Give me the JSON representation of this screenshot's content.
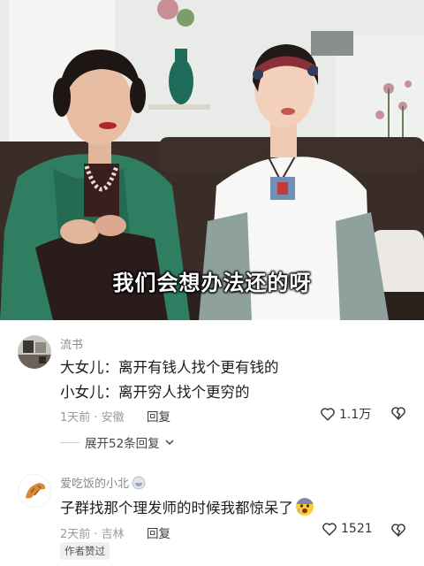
{
  "video": {
    "subtitle": "我们会想办法还的呀"
  },
  "comments": [
    {
      "username": "流书",
      "lines": [
        "大女儿：离开有钱人找个更有钱的",
        "小女儿：离开穷人找个更穷的"
      ],
      "meta": "1天前 · 安徽",
      "reply_label": "回复",
      "likes": "1.1万",
      "expand_label": "展开52条回复"
    },
    {
      "username": "爱吃饭的小北",
      "lines": [
        "子群找那个理发师的时候我都惊呆了"
      ],
      "meta": "2天前 · 吉林",
      "reply_label": "回复",
      "likes": "1521",
      "badge": "作者赞过"
    }
  ]
}
